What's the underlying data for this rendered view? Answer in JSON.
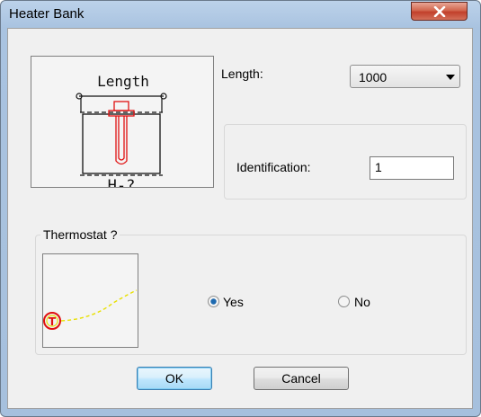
{
  "window": {
    "title": "Heater Bank"
  },
  "heater_picture": {
    "label_top": "Length",
    "label_bottom": "H-?"
  },
  "length": {
    "label": "Length:",
    "value": "1000"
  },
  "identification": {
    "label": "Identification:",
    "value": "1"
  },
  "thermostat": {
    "title": "Thermostat ?",
    "symbol": "T",
    "options": [
      {
        "label": "Yes",
        "selected": true
      },
      {
        "label": "No",
        "selected": false
      }
    ]
  },
  "buttons": {
    "ok": "OK",
    "cancel": "Cancel"
  },
  "icons": {
    "close": "close-icon",
    "dropdown": "chevron-down-icon"
  },
  "colors": {
    "titlebar": "#a9c3e0",
    "close_button": "#c2402b",
    "heater_element": "#e01010",
    "thermostat_line": "#e8e000"
  }
}
